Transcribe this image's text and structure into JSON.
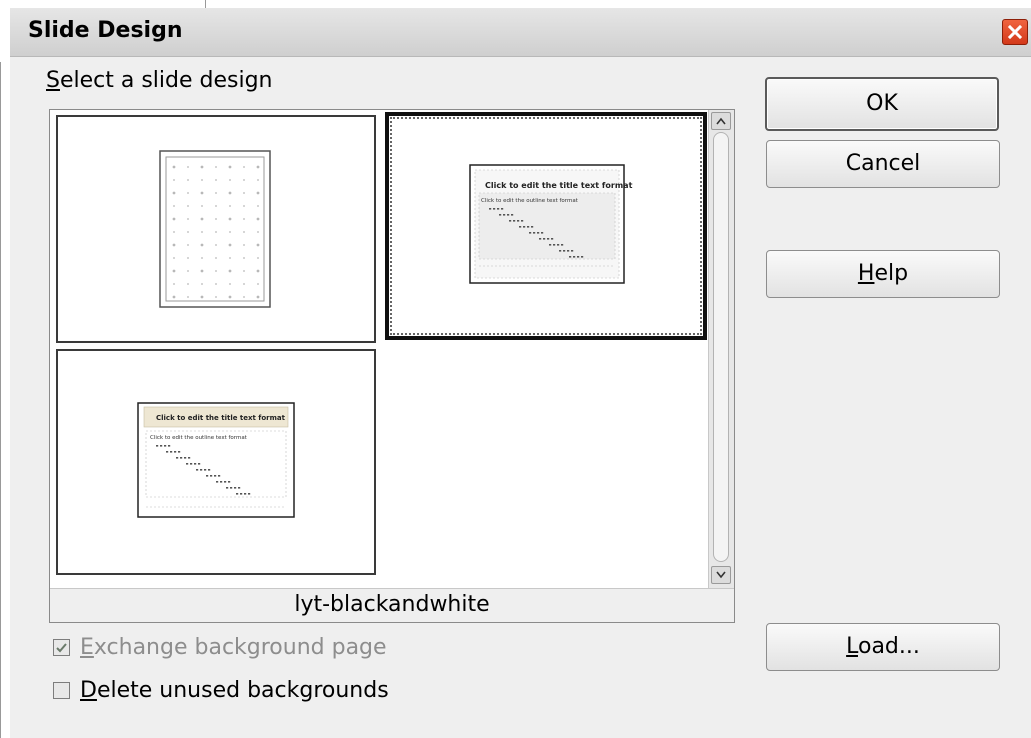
{
  "dialog": {
    "title": "Slide Design",
    "close_icon": "close-icon",
    "accent_close": "#e0472a"
  },
  "section": {
    "label_first": "S",
    "label_rest": "elect a slide design"
  },
  "designs": [
    {
      "name": "page-grid-design",
      "selected": false
    },
    {
      "name": "lyt-blackandwhite",
      "selected": true
    },
    {
      "name": "beige-title-design",
      "selected": false
    }
  ],
  "selected_design_name": "lyt-blackandwhite",
  "thumbnail_text": {
    "title_placeholder": "Click to edit the title text format",
    "outline_placeholder": "Click to edit the outline text format"
  },
  "options": {
    "exchange_first": "E",
    "exchange_rest": "xchange background page",
    "exchange_checked": true,
    "exchange_disabled": true,
    "delete_first": "D",
    "delete_rest": "elete unused backgrounds",
    "delete_checked": false
  },
  "buttons": {
    "ok": "OK",
    "cancel": "Cancel",
    "help_first": "H",
    "help_rest": "elp",
    "load_first": "L",
    "load_rest": "oad..."
  },
  "icons": {
    "scroll_up": "arrow-up-icon",
    "scroll_down": "arrow-down-icon",
    "check": "check-icon"
  }
}
